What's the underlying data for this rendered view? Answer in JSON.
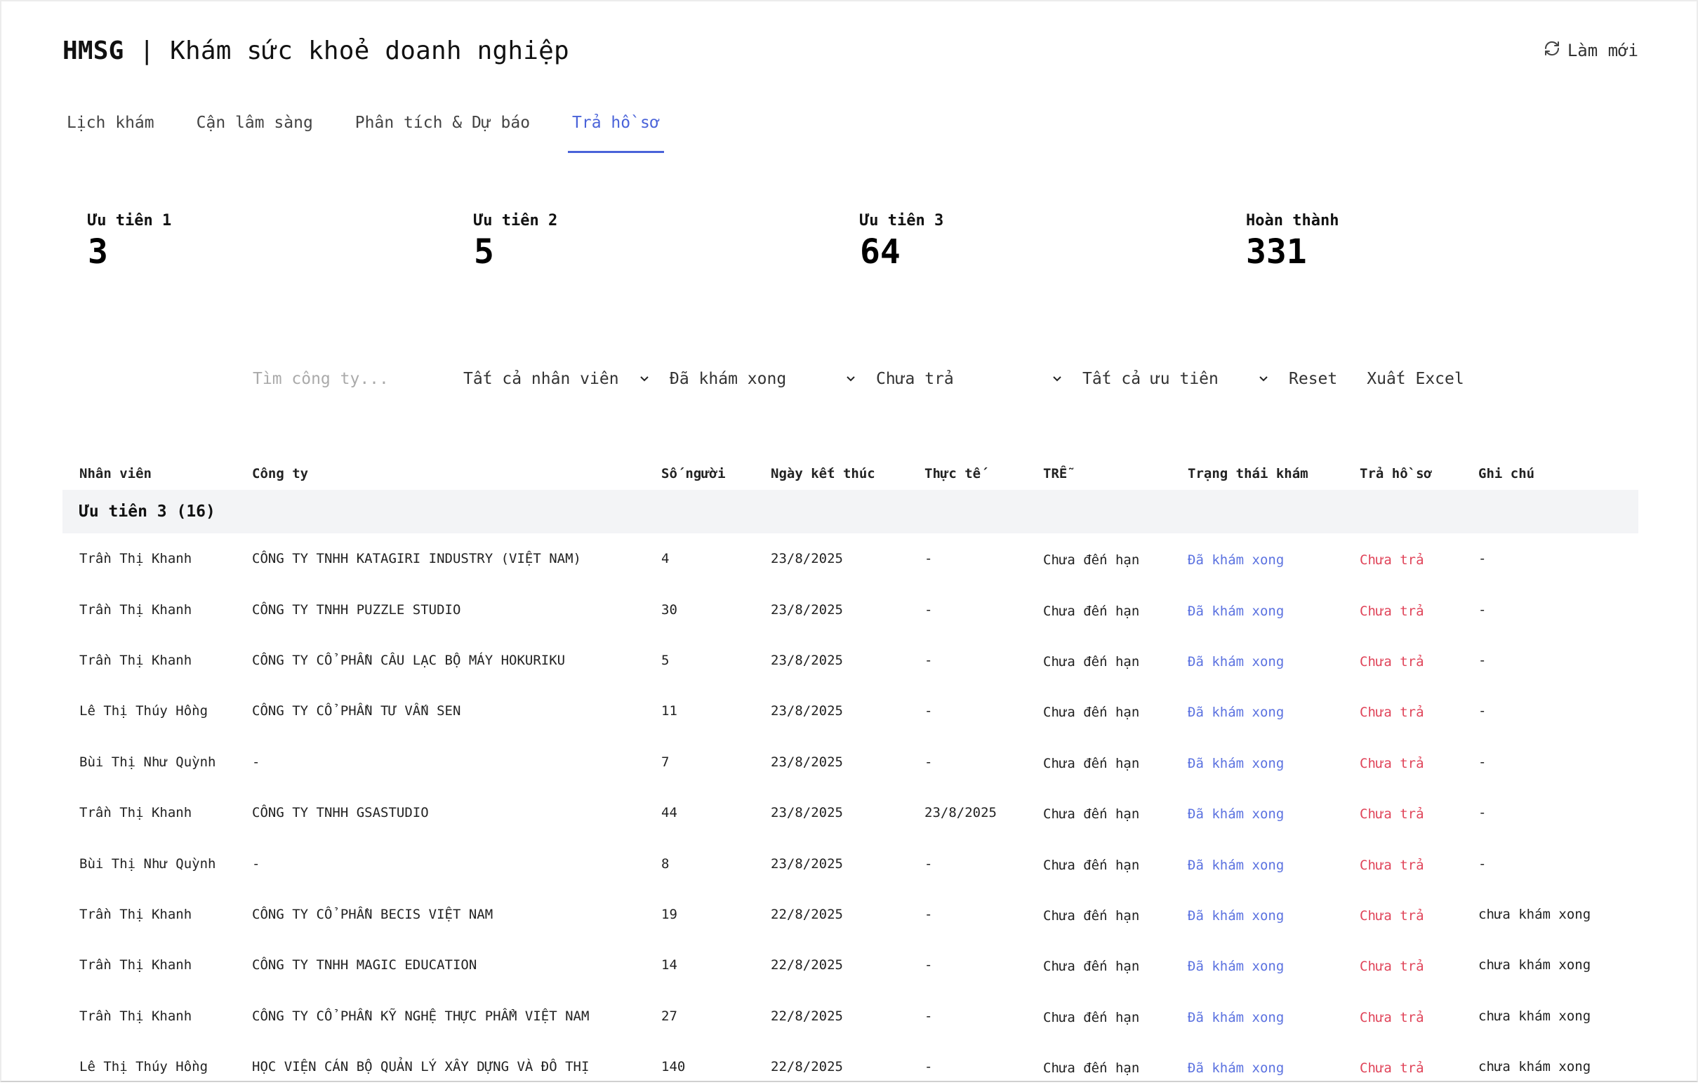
{
  "header": {
    "brand": "HMSG",
    "title": " | Khám sức khoẻ doanh nghiệp",
    "refresh_label": "Làm mới"
  },
  "tabs": [
    {
      "label": "Lịch khám",
      "active": false
    },
    {
      "label": "Cận lâm sàng",
      "active": false
    },
    {
      "label": "Phân tích & Dự báo",
      "active": false
    },
    {
      "label": "Trả hồ sơ",
      "active": true
    }
  ],
  "stats": [
    {
      "label": "Ưu tiên 1",
      "value": "3"
    },
    {
      "label": "Ưu tiên 2",
      "value": "5"
    },
    {
      "label": "Ưu tiên 3",
      "value": "64"
    },
    {
      "label": "Hoàn thành",
      "value": "331"
    }
  ],
  "filters": {
    "search_placeholder": "Tìm công ty...",
    "staff": "Tất cả nhân viên",
    "exam_status": "Đã khám xong",
    "return_status": "Chưa trả",
    "priority": "Tất cả ưu tiên",
    "reset_label": "Reset",
    "export_label": "Xuất Excel"
  },
  "table": {
    "columns": [
      "Nhân viên",
      "Công ty",
      "Số người",
      "Ngày kết thúc",
      "Thực tế",
      "TRỄ",
      "Trạng thái khám",
      "Trả hồ sơ",
      "Ghi chú"
    ],
    "group_label": "Ưu tiên 3 (16)",
    "rows": [
      [
        "Trần Thị Khanh",
        "CÔNG TY TNHH KATAGIRI INDUSTRY (VIỆT NAM)",
        "4",
        "23/8/2025",
        "-",
        "Chưa đến hạn",
        "Đã khám xong",
        "Chưa trả",
        "-"
      ],
      [
        "Trần Thị Khanh",
        "CÔNG TY TNHH PUZZLE STUDIO",
        "30",
        "23/8/2025",
        "-",
        "Chưa đến hạn",
        "Đã khám xong",
        "Chưa trả",
        "-"
      ],
      [
        "Trần Thị Khanh",
        "CÔNG TY CỔ PHẦN CÂU LẠC BỘ MÁY HOKURIKU",
        "5",
        "23/8/2025",
        "-",
        "Chưa đến hạn",
        "Đã khám xong",
        "Chưa trả",
        "-"
      ],
      [
        "Lê Thị Thúy Hồng",
        "CÔNG TY CỔ PHẦN TƯ VẤN SEN",
        "11",
        "23/8/2025",
        "-",
        "Chưa đến hạn",
        "Đã khám xong",
        "Chưa trả",
        "-"
      ],
      [
        "Bùi Thị Như Quỳnh",
        "-",
        "7",
        "23/8/2025",
        "-",
        "Chưa đến hạn",
        "Đã khám xong",
        "Chưa trả",
        "-"
      ],
      [
        "Trần Thị Khanh",
        "CÔNG TY TNHH GSASTUDIO",
        "44",
        "23/8/2025",
        "23/8/2025",
        "Chưa đến hạn",
        "Đã khám xong",
        "Chưa trả",
        "-"
      ],
      [
        "Bùi Thị Như Quỳnh",
        "-",
        "8",
        "23/8/2025",
        "-",
        "Chưa đến hạn",
        "Đã khám xong",
        "Chưa trả",
        "-"
      ],
      [
        "Trần Thị Khanh",
        "CÔNG TY CỔ PHẦN BECIS VIỆT NAM",
        "19",
        "22/8/2025",
        "-",
        "Chưa đến hạn",
        "Đã khám xong",
        "Chưa trả",
        "chưa khám xong"
      ],
      [
        "Trần Thị Khanh",
        "CÔNG TY TNHH MAGIC EDUCATION",
        "14",
        "22/8/2025",
        "-",
        "Chưa đến hạn",
        "Đã khám xong",
        "Chưa trả",
        "chưa khám xong"
      ],
      [
        "Trần Thị Khanh",
        "CÔNG TY CỔ PHẦN KỸ NGHỆ THỰC PHẨM VIỆT NAM",
        "27",
        "22/8/2025",
        "-",
        "Chưa đến hạn",
        "Đã khám xong",
        "Chưa trả",
        "chưa khám xong"
      ],
      [
        "Lê Thị Thúy Hồng",
        "HỌC VIỆN CÁN BỘ QUẢN LÝ XÂY DỰNG VÀ ĐÔ THỊ",
        "140",
        "22/8/2025",
        "-",
        "Chưa đến hạn",
        "Đã khám xong",
        "Chưa trả",
        "chưa khám xong"
      ]
    ]
  },
  "colors": {
    "accent": "#4a63d9",
    "status_blue": "#5b72e0",
    "status_red": "#e0455a",
    "group_bg": "#f3f4f6"
  },
  "icons": {
    "refresh": "refresh-icon",
    "dropdown": "chevron-down-icon"
  }
}
